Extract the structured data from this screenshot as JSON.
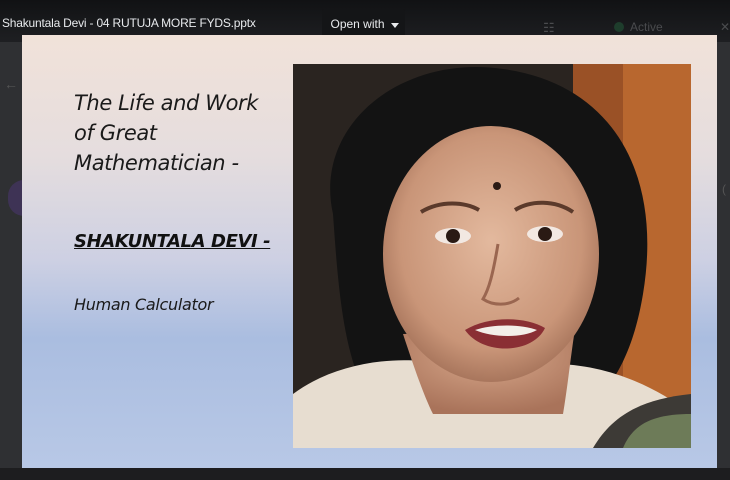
{
  "viewer": {
    "file_name": "Shakuntala Devi - 04 RUTUJA MORE FYDS.pptx",
    "open_with_label": "Open with",
    "status_label": "Active"
  },
  "slide": {
    "title_lines": [
      "The Life and Work",
      "of Great",
      "Mathematician -"
    ],
    "name": "SHAKUNTALA DEVI -",
    "subtitle": "Human Calculator"
  }
}
